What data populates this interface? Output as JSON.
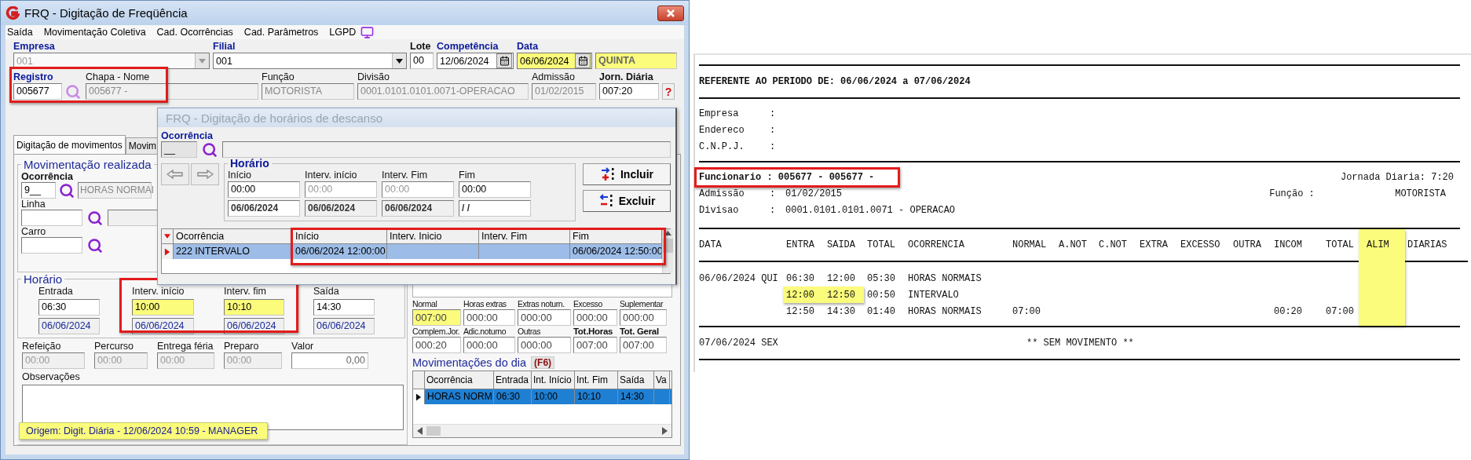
{
  "main_window": {
    "title": "FRQ - Digitação de Freqüência",
    "menu": [
      {
        "label": "Saída"
      },
      {
        "label": "Movimentação Coletiva"
      },
      {
        "label": "Cad. Ocorrências"
      },
      {
        "label": "Cad. Parâmetros"
      },
      {
        "label": "LGPD"
      }
    ],
    "header": {
      "empresa": {
        "label": "Empresa",
        "value": "001",
        "disabled": true
      },
      "filial": {
        "label": "Filial",
        "value": "001",
        "disabled": false
      },
      "lote": {
        "label": "Lote",
        "value": "00"
      },
      "competencia": {
        "label": "Competência",
        "value": "12/06/2024",
        "highlighted": false
      },
      "data": {
        "label": "Data",
        "value": "06/06/2024",
        "highlighted": true
      },
      "weekday": {
        "value": "QUINTA",
        "highlighted": true
      },
      "registro": {
        "label": "Registro",
        "value": "005677"
      },
      "chapa_nome": {
        "label": "Chapa  -  Nome",
        "value": "005677 -",
        "disabled": true
      },
      "registro_annotated": true,
      "funcao": {
        "label": "Função",
        "value": "MOTORISTA",
        "disabled": true
      },
      "divisao": {
        "label": "Divisão",
        "value": "0001.0101.0101.0071-OPERACAO",
        "disabled": true
      },
      "admissao": {
        "label": "Admissão",
        "value": "01/02/2015",
        "disabled": true
      },
      "jornada": {
        "label": "Jorn. Diária",
        "value": "007:20"
      },
      "help": "?"
    },
    "tabs": [
      {
        "label": "Digitação de movimentos",
        "selected": true
      },
      {
        "label": "Movim",
        "selected": false
      }
    ],
    "movimentacao": {
      "legend": "Movimentação realizada",
      "ocorrencia": {
        "label": "Ocorrência",
        "code": "9__",
        "description": "HORAS NORMAI"
      },
      "linha": {
        "label": "Linha"
      },
      "carro": {
        "label": "Carro"
      }
    },
    "horario": {
      "legend": "Horário",
      "annotated": true,
      "fields": [
        {
          "label": "Entrada",
          "time": "06:30",
          "date": "06/06/2024",
          "highlighted": false
        },
        {
          "label": "Interv. início",
          "time": "10:00",
          "date": "06/06/2024",
          "highlighted": true
        },
        {
          "label": "Interv. fim",
          "time": "10:10",
          "date": "06/06/2024",
          "highlighted": true
        },
        {
          "label": "Saída",
          "time": "14:30",
          "date": "06/06/2024",
          "highlighted": false
        }
      ]
    },
    "extras": [
      {
        "label": "Refeição",
        "value": "00:00",
        "kind": "time"
      },
      {
        "label": "Percurso",
        "value": "00:00",
        "kind": "time"
      },
      {
        "label": "Entrega féria",
        "value": "00:00",
        "kind": "time"
      },
      {
        "label": "Preparo",
        "value": "00:00",
        "kind": "time"
      },
      {
        "label": "Valor",
        "value": "0,00",
        "kind": "number"
      }
    ],
    "observacoes": {
      "label": "Observações"
    },
    "origin": "Origem: Digit. Diária - 12/06/2024 10:59 - MANAGER",
    "totals": [
      {
        "label": "Normal",
        "value": "007:00",
        "highlighted": true,
        "bold": false
      },
      {
        "label": "Horas extras",
        "value": "000:00",
        "highlighted": false,
        "bold": false
      },
      {
        "label": "Extras noturn.",
        "value": "000:00",
        "highlighted": false,
        "bold": false
      },
      {
        "label": "Excesso",
        "value": "000:00",
        "highlighted": false,
        "bold": false
      },
      {
        "label": "Suplementar",
        "value": "000:00",
        "highlighted": false,
        "bold": false
      },
      {
        "label": "Complem.Jor.",
        "value": "000:20",
        "highlighted": false,
        "bold": false
      },
      {
        "label": "Adic.noturno",
        "value": "000:00",
        "highlighted": false,
        "bold": false
      },
      {
        "label": "Outras",
        "value": "000:00",
        "highlighted": false,
        "bold": false
      },
      {
        "label": "Tot.Horas",
        "value": "007:00",
        "highlighted": false,
        "bold": true
      },
      {
        "label": "Tot. Geral",
        "value": "007:00",
        "highlighted": false,
        "bold": true
      }
    ],
    "movimentacoes": {
      "title": "Movimentações do dia",
      "shortcut": "(F6)",
      "columns": [
        "Ocorrência",
        "Entrada",
        "Int. Início",
        "Int. Fim",
        "Saída",
        "Va"
      ],
      "rows": [
        {
          "cells": [
            "HORAS NORM",
            "06:30",
            "10:00",
            "10:10",
            "14:30",
            null
          ],
          "selected": true
        }
      ]
    }
  },
  "dialog": {
    "title": "FRQ - Digitação de horários de descanso",
    "ocorrencia": {
      "label": "Ocorrência",
      "code": "__"
    },
    "horario": {
      "legend": "Horário",
      "fields": [
        {
          "label": "Início",
          "time": "00:00",
          "date": "06/06/2024",
          "disabled": false
        },
        {
          "label": "Interv. início",
          "time": "00:00",
          "date": "06/06/2024",
          "disabled": true
        },
        {
          "label": "Interv. Fim",
          "time": "00:00",
          "date": "06/06/2024",
          "disabled": true
        },
        {
          "label": "Fim",
          "time": "00:00",
          "date": "/ /",
          "disabled": false
        }
      ]
    },
    "buttons": [
      {
        "label": "Incluir",
        "kind": "add"
      },
      {
        "label": "Excluir",
        "kind": "remove"
      }
    ],
    "grid": {
      "annotated": true,
      "columns": [
        "Ocorrência",
        "Início",
        "Interv. Inicio",
        "Interv. Fim",
        "Fim"
      ],
      "rows": [
        {
          "cells": [
            "222 INTERVALO",
            "06/06/2024 12:00:00",
            null,
            null,
            "06/06/2024 12:50:00"
          ],
          "selected": true
        }
      ]
    }
  },
  "report": {
    "period": "REFERENTE AO PERIODO DE: 06/06/2024 a 07/06/2024",
    "company": [
      {
        "label": "Empresa",
        "separator": ":"
      },
      {
        "label": "Endereco",
        "separator": ":"
      },
      {
        "label": "C.N.P.J.",
        "separator": ":"
      }
    ],
    "employee": {
      "text": "Funcionario : 005677 - 005677 -",
      "annotated": true
    },
    "jornada": "Jornada Diaria: 7:20",
    "admissao": {
      "label": "Admissão",
      "separator": ":",
      "value": "01/02/2015"
    },
    "funcao": {
      "label": "Função :",
      "value": "MOTORISTA"
    },
    "divisao": {
      "label": "Divisao",
      "separator": ":",
      "value": "0001.0101.0101.0071 - OPERACAO"
    },
    "columns": [
      {
        "label": "DATA",
        "highlighted": false
      },
      {
        "label": "ENTRA",
        "highlighted": false
      },
      {
        "label": "SAIDA",
        "highlighted": false
      },
      {
        "label": "TOTAL",
        "highlighted": false
      },
      {
        "label": "OCORRENCIA",
        "highlighted": false
      },
      {
        "label": "NORMAL",
        "highlighted": false
      },
      {
        "label": "A.NOT",
        "highlighted": false
      },
      {
        "label": "C.NOT",
        "highlighted": false
      },
      {
        "label": "EXTRA",
        "highlighted": false
      },
      {
        "label": "EXCESSO",
        "highlighted": false
      },
      {
        "label": "OUTRA",
        "highlighted": false
      },
      {
        "label": "INCOM",
        "highlighted": false
      },
      {
        "label": "TOTAL",
        "highlighted": false
      },
      {
        "label": "ALIM",
        "highlighted": true
      },
      {
        "label": "DIARIAS",
        "highlighted": false
      }
    ],
    "rows": [
      {
        "cells": [
          "06/06/2024 QUI",
          "06:30",
          "12:00",
          "05:30",
          "HORAS NORMAIS",
          null,
          null,
          null,
          null,
          null,
          null,
          null,
          null,
          null,
          null
        ],
        "highlighted": false
      },
      {
        "cells": [
          null,
          "12:00",
          "12:50",
          "00:50",
          "INTERVALO",
          null,
          null,
          null,
          null,
          null,
          null,
          null,
          null,
          null,
          null
        ],
        "highlighted": true
      },
      {
        "cells": [
          null,
          "12:50",
          "14:30",
          "01:40",
          "HORAS NORMAIS",
          "07:00",
          null,
          null,
          null,
          null,
          null,
          "00:20",
          "07:00",
          null,
          null
        ],
        "highlighted": false
      }
    ],
    "no_movement": {
      "date": "07/06/2024 SEX",
      "message": "** SEM MOVIMENTO **"
    }
  }
}
